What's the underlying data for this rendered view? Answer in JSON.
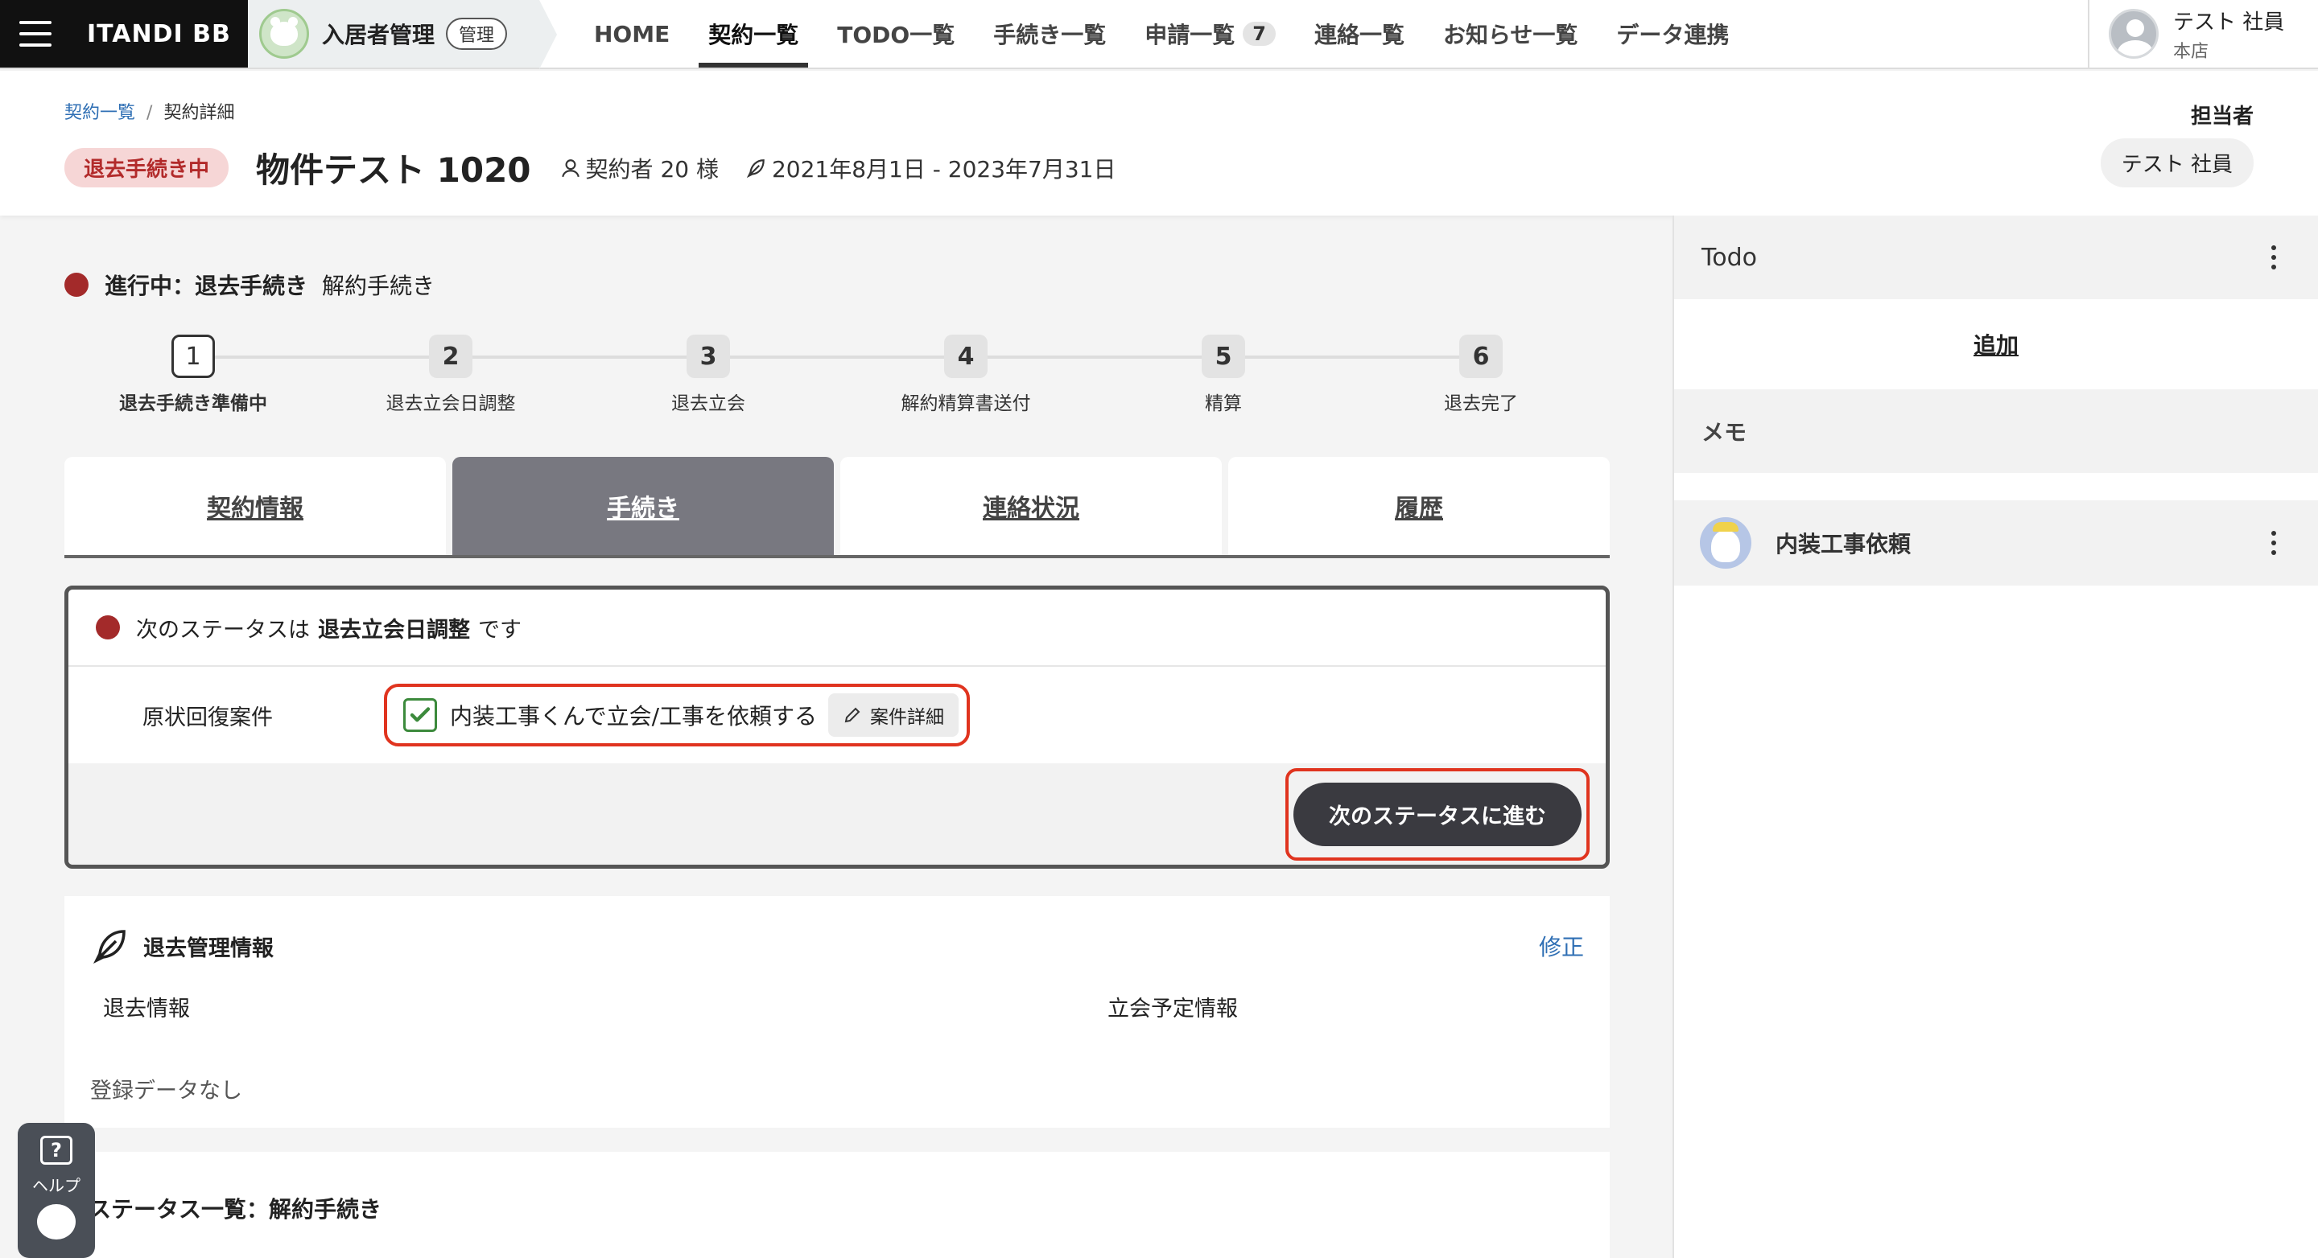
{
  "nav": {
    "brand": "ITANDI BB",
    "app_name": "入居者管理",
    "app_badge": "管理",
    "items": [
      {
        "label": "HOME"
      },
      {
        "label": "契約一覧"
      },
      {
        "label": "TODO一覧"
      },
      {
        "label": "手続き一覧"
      },
      {
        "label": "申請一覧",
        "count": "7"
      },
      {
        "label": "連絡一覧"
      },
      {
        "label": "お知らせ一覧"
      },
      {
        "label": "データ連携"
      }
    ],
    "user_name": "テスト 社員",
    "user_branch": "本店"
  },
  "header": {
    "breadcrumb": [
      "契約一覧",
      "契約詳細"
    ],
    "breadcrumb_sep": "/",
    "status_pill": "退去手続き中",
    "title": "物件テスト 1020",
    "contractor": "契約者 20 様",
    "period": "2021年8月1日 - 2023年7月31日",
    "assignee_label": "担当者",
    "assignee_name": "テスト 社員"
  },
  "progress": {
    "status_prefix": "進行中：退去手続き",
    "status_sub": "解約手続き",
    "steps": [
      {
        "num": "1",
        "label": "退去手続き準備中"
      },
      {
        "num": "2",
        "label": "退去立会日調整"
      },
      {
        "num": "3",
        "label": "退去立会"
      },
      {
        "num": "4",
        "label": "解約精算書送付"
      },
      {
        "num": "5",
        "label": "精算"
      },
      {
        "num": "6",
        "label": "退去完了"
      }
    ],
    "current_step": 1
  },
  "tabs": [
    {
      "label": "契約情報"
    },
    {
      "label": "手続き"
    },
    {
      "label": "連絡状況"
    },
    {
      "label": "履歴"
    }
  ],
  "status_card": {
    "next_prefix": "次のステータスは",
    "next_status": "退去立会日調整",
    "next_suffix": "です",
    "field_label": "原状回復案件",
    "task_text": "内装工事くんで立会/工事を依頼する",
    "task_checked": true,
    "detail_button": "案件詳細",
    "next_button": "次のステータスに進む"
  },
  "leave_info": {
    "title": "退去管理情報",
    "edit": "修正",
    "sub_left": "退去情報",
    "sub_right": "立会予定情報",
    "nodata": "登録データなし"
  },
  "status_list": {
    "title": "ステータス一覧：解約手続き"
  },
  "help": {
    "label": "ヘルプ"
  },
  "side": {
    "todo_title": "Todo",
    "add_label": "追加",
    "memo_title": "メモ",
    "memo_items": [
      {
        "text": "内装工事依頼"
      }
    ]
  },
  "colors": {
    "accent_dark": "#3a3a40",
    "status_red": "#a32a2a",
    "highlight_border": "#e0341f",
    "link_blue": "#2f6fb4"
  }
}
